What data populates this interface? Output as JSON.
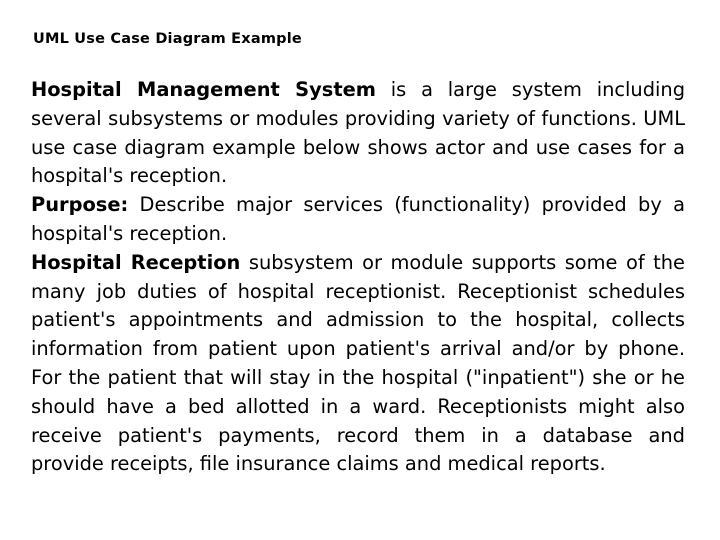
{
  "page": {
    "background_color": "#ffffff",
    "text_color": "#000000"
  },
  "title": {
    "text": "UML Use Case Diagram Example"
  },
  "body": {
    "paragraphs": [
      {
        "lead": "Hospital Management System",
        "text": " is a large system including several subsystems or modules providing variety of functions. UML use case diagram example below shows actor and use cases for a hospital's reception."
      },
      {
        "lead": "Purpose:",
        "text": " Describe major services (functionality) provided by a hospital's reception."
      },
      {
        "lead": "Hospital Reception",
        "text": " subsystem or module supports some of the many job duties of hospital receptionist. Receptionist schedules patient's appointments and admission to the hospital, collects information from patient upon patient's arrival and/or by phone. For the patient that will stay in the hospital (\"inpatient\") she or he should have a bed allotted in a ward. Receptionists might also receive patient's payments, record them in a database and provide receipts, file insurance claims and medical reports."
      }
    ]
  }
}
